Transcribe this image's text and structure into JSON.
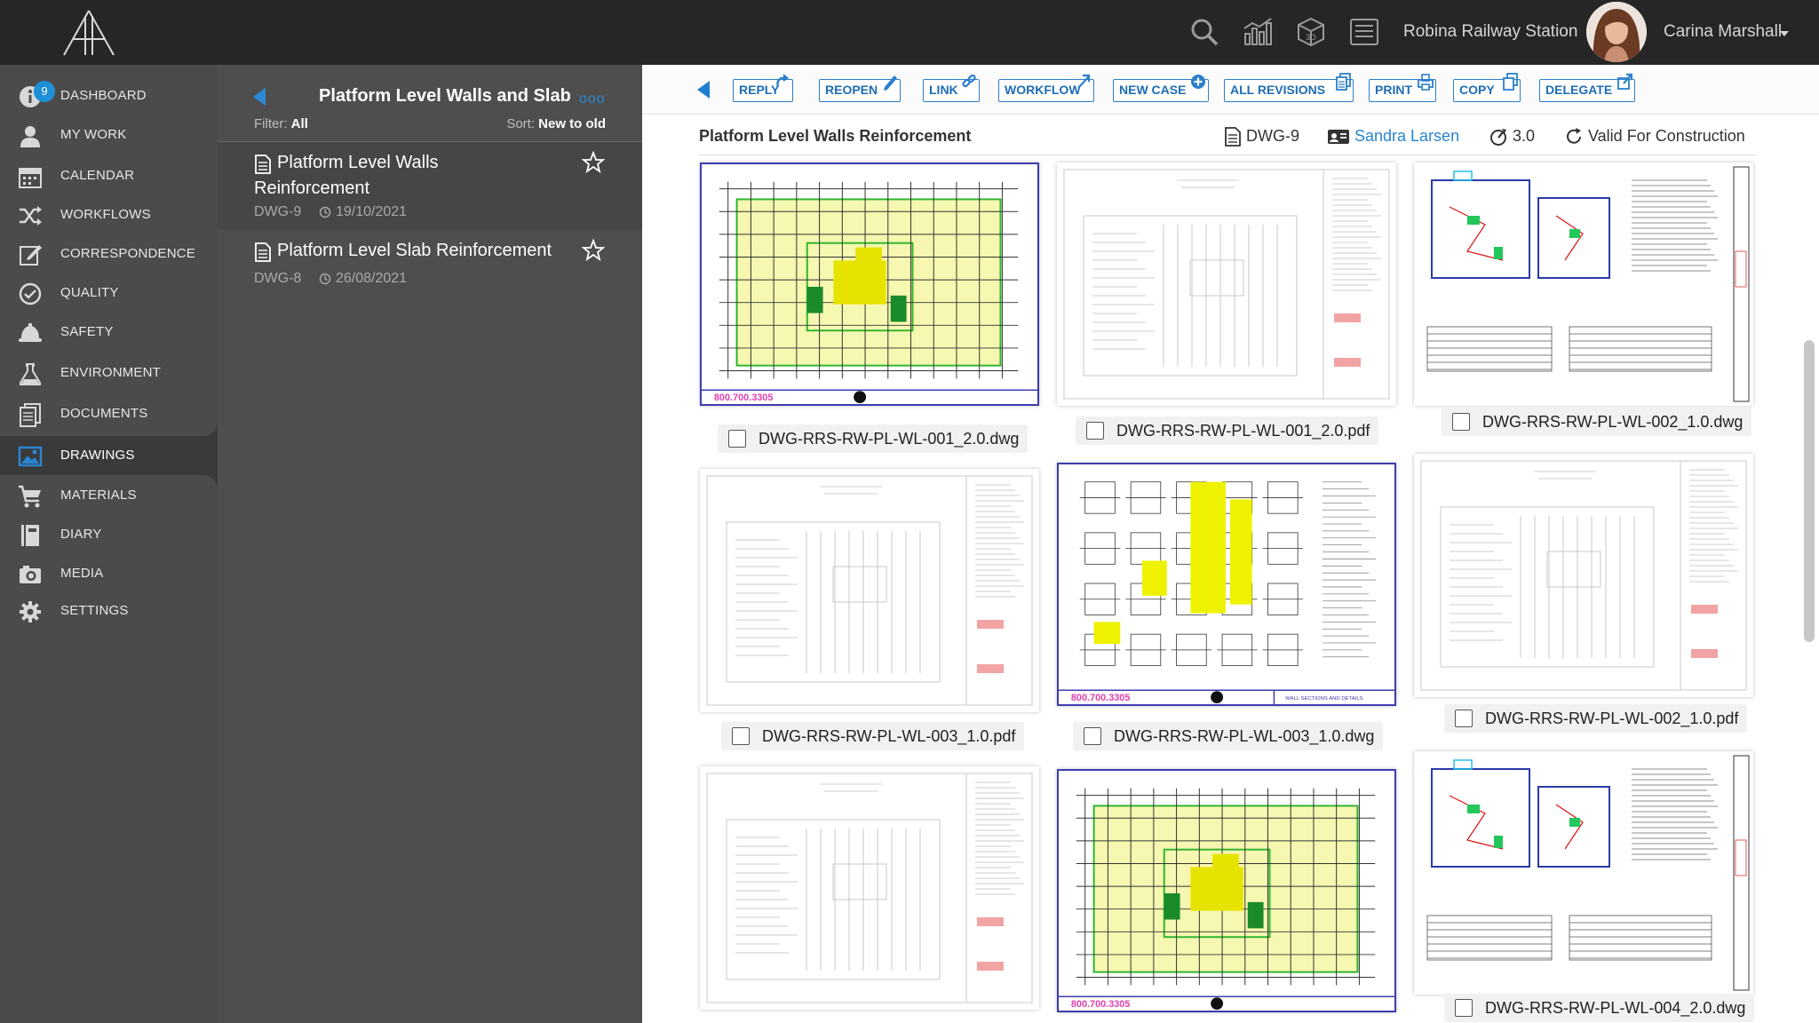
{
  "topbar": {
    "project_name": "Robina Railway Station",
    "user_name": "Carina Marshall",
    "icons": [
      "search-icon",
      "chart-icon",
      "3d-model-icon",
      "list-icon"
    ]
  },
  "sidebar": {
    "badge_count": "9",
    "items": [
      {
        "label": "DASHBOARD",
        "icon": "info-icon"
      },
      {
        "label": "MY WORK",
        "icon": "user-icon"
      },
      {
        "label": "CALENDAR",
        "icon": "calendar-icon"
      },
      {
        "label": "WORKFLOWS",
        "icon": "shuffle-icon"
      },
      {
        "label": "CORRESPONDENCE",
        "icon": "edit-icon"
      },
      {
        "label": "QUALITY",
        "icon": "check-circle-icon"
      },
      {
        "label": "SAFETY",
        "icon": "hard-hat-icon"
      },
      {
        "label": "ENVIRONMENT",
        "icon": "flask-icon"
      },
      {
        "label": "DOCUMENTS",
        "icon": "documents-icon"
      },
      {
        "label": "DRAWINGS",
        "icon": "image-icon"
      },
      {
        "label": "MATERIALS",
        "icon": "cart-icon"
      },
      {
        "label": "DIARY",
        "icon": "book-icon"
      },
      {
        "label": "MEDIA",
        "icon": "camera-icon"
      },
      {
        "label": "SETTINGS",
        "icon": "gear-icon"
      }
    ],
    "active": "DRAWINGS"
  },
  "list_panel": {
    "title": "Platform Level Walls and Slab",
    "more": "ooo",
    "filter_label": "Filter:",
    "filter_value": "All",
    "sort_label": "Sort:",
    "sort_value": "New to old",
    "items": [
      {
        "title": "Platform Level Walls Reinforcement",
        "code": "DWG-9",
        "date": "19/10/2021"
      },
      {
        "title": "Platform Level Slab Reinforcement",
        "code": "DWG-8",
        "date": "26/08/2021"
      }
    ]
  },
  "toolbar": {
    "buttons": [
      "REPLY",
      "REOPEN",
      "LINK",
      "WORKFLOW",
      "NEW CASE",
      "ALL REVISIONS",
      "PRINT",
      "COPY",
      "DELEGATE"
    ]
  },
  "document": {
    "title": "Platform Level Walls Reinforcement",
    "code": "DWG-9",
    "owner": "Sandra Larsen",
    "revision": "3.0",
    "status": "Valid For Construction"
  },
  "files": [
    {
      "name": "DWG-RRS-RW-PL-WL-001_2.0.dwg",
      "preview": "color-plan"
    },
    {
      "name": "DWG-RRS-RW-PL-WL-001_2.0.pdf",
      "preview": "line-sheet"
    },
    {
      "name": "DWG-RRS-RW-PL-WL-002_1.0.dwg",
      "preview": "color-floor"
    },
    {
      "name": "DWG-RRS-RW-PL-WL-003_1.0.pdf",
      "preview": "line-sheet"
    },
    {
      "name": "DWG-RRS-RW-PL-WL-003_1.0.dwg",
      "preview": "color-details"
    },
    {
      "name": "DWG-RRS-RW-PL-WL-002_1.0.pdf",
      "preview": "line-sheet"
    },
    {
      "name": "",
      "preview": "line-sheet"
    },
    {
      "name": "",
      "preview": "color-plan"
    },
    {
      "name": "DWG-RRS-RW-PL-WL-004_2.0.dwg",
      "preview": "color-floor"
    }
  ],
  "thumb_stamp": "800.700.3305",
  "thumb_stamp2": "WALL SECTIONS AND DETAILS",
  "colors": {
    "accent": "#2a85d0",
    "topbar": "#262626",
    "sidebar": "#4b4b4b"
  }
}
